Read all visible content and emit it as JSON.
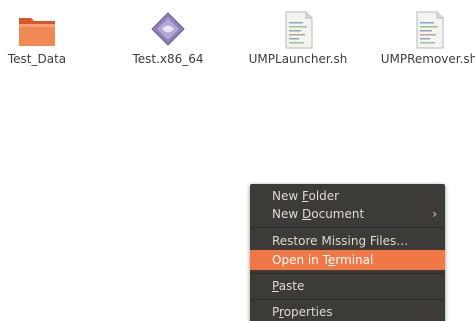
{
  "desktop": {
    "files": [
      {
        "name": "Test_Data",
        "icon": "folder-icon"
      },
      {
        "name": "Test.x86_64",
        "icon": "executable-icon"
      },
      {
        "name": "UMPLauncher.sh",
        "icon": "script-file-icon"
      },
      {
        "name": "UMPRemover.sh",
        "icon": "script-file-icon"
      }
    ]
  },
  "context_menu": {
    "new_folder": {
      "pre": "New ",
      "mnemonic": "F",
      "post": "older"
    },
    "new_document": {
      "pre": "New ",
      "mnemonic": "D",
      "post": "ocument",
      "arrow": "›"
    },
    "restore_missing": "Restore Missing Files…",
    "open_in_terminal": {
      "pre": "Open in T",
      "mnemonic": "e",
      "post": "rminal"
    },
    "paste": {
      "pre": "",
      "mnemonic": "P",
      "post": "aste"
    },
    "properties": {
      "pre": "P",
      "mnemonic": "r",
      "post": "operties"
    },
    "highlight_color": "#f07746",
    "background_color": "#3c3b37"
  }
}
